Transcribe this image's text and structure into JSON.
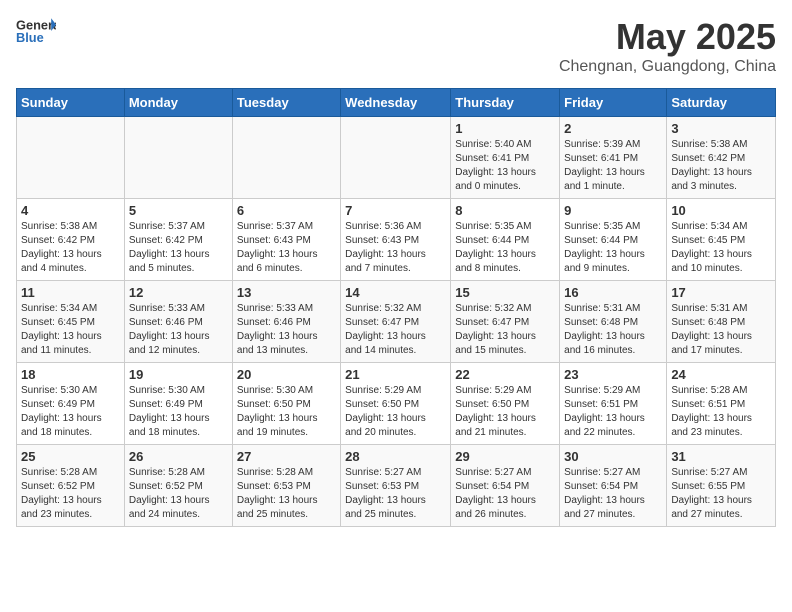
{
  "logo": {
    "general": "General",
    "blue": "Blue"
  },
  "title": {
    "month": "May 2025",
    "location": "Chengnan, Guangdong, China"
  },
  "weekdays": [
    "Sunday",
    "Monday",
    "Tuesday",
    "Wednesday",
    "Thursday",
    "Friday",
    "Saturday"
  ],
  "weeks": [
    [
      {
        "day": "",
        "info": ""
      },
      {
        "day": "",
        "info": ""
      },
      {
        "day": "",
        "info": ""
      },
      {
        "day": "",
        "info": ""
      },
      {
        "day": "1",
        "info": "Sunrise: 5:40 AM\nSunset: 6:41 PM\nDaylight: 13 hours\nand 0 minutes."
      },
      {
        "day": "2",
        "info": "Sunrise: 5:39 AM\nSunset: 6:41 PM\nDaylight: 13 hours\nand 1 minute."
      },
      {
        "day": "3",
        "info": "Sunrise: 5:38 AM\nSunset: 6:42 PM\nDaylight: 13 hours\nand 3 minutes."
      }
    ],
    [
      {
        "day": "4",
        "info": "Sunrise: 5:38 AM\nSunset: 6:42 PM\nDaylight: 13 hours\nand 4 minutes."
      },
      {
        "day": "5",
        "info": "Sunrise: 5:37 AM\nSunset: 6:42 PM\nDaylight: 13 hours\nand 5 minutes."
      },
      {
        "day": "6",
        "info": "Sunrise: 5:37 AM\nSunset: 6:43 PM\nDaylight: 13 hours\nand 6 minutes."
      },
      {
        "day": "7",
        "info": "Sunrise: 5:36 AM\nSunset: 6:43 PM\nDaylight: 13 hours\nand 7 minutes."
      },
      {
        "day": "8",
        "info": "Sunrise: 5:35 AM\nSunset: 6:44 PM\nDaylight: 13 hours\nand 8 minutes."
      },
      {
        "day": "9",
        "info": "Sunrise: 5:35 AM\nSunset: 6:44 PM\nDaylight: 13 hours\nand 9 minutes."
      },
      {
        "day": "10",
        "info": "Sunrise: 5:34 AM\nSunset: 6:45 PM\nDaylight: 13 hours\nand 10 minutes."
      }
    ],
    [
      {
        "day": "11",
        "info": "Sunrise: 5:34 AM\nSunset: 6:45 PM\nDaylight: 13 hours\nand 11 minutes."
      },
      {
        "day": "12",
        "info": "Sunrise: 5:33 AM\nSunset: 6:46 PM\nDaylight: 13 hours\nand 12 minutes."
      },
      {
        "day": "13",
        "info": "Sunrise: 5:33 AM\nSunset: 6:46 PM\nDaylight: 13 hours\nand 13 minutes."
      },
      {
        "day": "14",
        "info": "Sunrise: 5:32 AM\nSunset: 6:47 PM\nDaylight: 13 hours\nand 14 minutes."
      },
      {
        "day": "15",
        "info": "Sunrise: 5:32 AM\nSunset: 6:47 PM\nDaylight: 13 hours\nand 15 minutes."
      },
      {
        "day": "16",
        "info": "Sunrise: 5:31 AM\nSunset: 6:48 PM\nDaylight: 13 hours\nand 16 minutes."
      },
      {
        "day": "17",
        "info": "Sunrise: 5:31 AM\nSunset: 6:48 PM\nDaylight: 13 hours\nand 17 minutes."
      }
    ],
    [
      {
        "day": "18",
        "info": "Sunrise: 5:30 AM\nSunset: 6:49 PM\nDaylight: 13 hours\nand 18 minutes."
      },
      {
        "day": "19",
        "info": "Sunrise: 5:30 AM\nSunset: 6:49 PM\nDaylight: 13 hours\nand 18 minutes."
      },
      {
        "day": "20",
        "info": "Sunrise: 5:30 AM\nSunset: 6:50 PM\nDaylight: 13 hours\nand 19 minutes."
      },
      {
        "day": "21",
        "info": "Sunrise: 5:29 AM\nSunset: 6:50 PM\nDaylight: 13 hours\nand 20 minutes."
      },
      {
        "day": "22",
        "info": "Sunrise: 5:29 AM\nSunset: 6:50 PM\nDaylight: 13 hours\nand 21 minutes."
      },
      {
        "day": "23",
        "info": "Sunrise: 5:29 AM\nSunset: 6:51 PM\nDaylight: 13 hours\nand 22 minutes."
      },
      {
        "day": "24",
        "info": "Sunrise: 5:28 AM\nSunset: 6:51 PM\nDaylight: 13 hours\nand 23 minutes."
      }
    ],
    [
      {
        "day": "25",
        "info": "Sunrise: 5:28 AM\nSunset: 6:52 PM\nDaylight: 13 hours\nand 23 minutes."
      },
      {
        "day": "26",
        "info": "Sunrise: 5:28 AM\nSunset: 6:52 PM\nDaylight: 13 hours\nand 24 minutes."
      },
      {
        "day": "27",
        "info": "Sunrise: 5:28 AM\nSunset: 6:53 PM\nDaylight: 13 hours\nand 25 minutes."
      },
      {
        "day": "28",
        "info": "Sunrise: 5:27 AM\nSunset: 6:53 PM\nDaylight: 13 hours\nand 25 minutes."
      },
      {
        "day": "29",
        "info": "Sunrise: 5:27 AM\nSunset: 6:54 PM\nDaylight: 13 hours\nand 26 minutes."
      },
      {
        "day": "30",
        "info": "Sunrise: 5:27 AM\nSunset: 6:54 PM\nDaylight: 13 hours\nand 27 minutes."
      },
      {
        "day": "31",
        "info": "Sunrise: 5:27 AM\nSunset: 6:55 PM\nDaylight: 13 hours\nand 27 minutes."
      }
    ]
  ]
}
